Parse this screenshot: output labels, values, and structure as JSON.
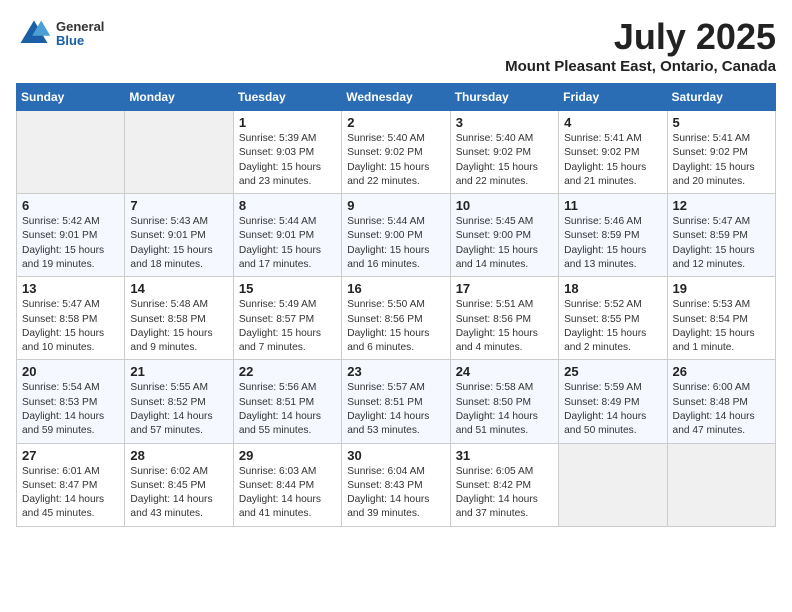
{
  "header": {
    "logo": {
      "general": "General",
      "blue": "Blue"
    },
    "title": "July 2025",
    "subtitle": "Mount Pleasant East, Ontario, Canada"
  },
  "weekdays": [
    "Sunday",
    "Monday",
    "Tuesday",
    "Wednesday",
    "Thursday",
    "Friday",
    "Saturday"
  ],
  "weeks": [
    [
      {
        "day": "",
        "empty": true
      },
      {
        "day": "",
        "empty": true
      },
      {
        "day": "1",
        "sunrise": "Sunrise: 5:39 AM",
        "sunset": "Sunset: 9:03 PM",
        "daylight": "Daylight: 15 hours and 23 minutes."
      },
      {
        "day": "2",
        "sunrise": "Sunrise: 5:40 AM",
        "sunset": "Sunset: 9:02 PM",
        "daylight": "Daylight: 15 hours and 22 minutes."
      },
      {
        "day": "3",
        "sunrise": "Sunrise: 5:40 AM",
        "sunset": "Sunset: 9:02 PM",
        "daylight": "Daylight: 15 hours and 22 minutes."
      },
      {
        "day": "4",
        "sunrise": "Sunrise: 5:41 AM",
        "sunset": "Sunset: 9:02 PM",
        "daylight": "Daylight: 15 hours and 21 minutes."
      },
      {
        "day": "5",
        "sunrise": "Sunrise: 5:41 AM",
        "sunset": "Sunset: 9:02 PM",
        "daylight": "Daylight: 15 hours and 20 minutes."
      }
    ],
    [
      {
        "day": "6",
        "sunrise": "Sunrise: 5:42 AM",
        "sunset": "Sunset: 9:01 PM",
        "daylight": "Daylight: 15 hours and 19 minutes."
      },
      {
        "day": "7",
        "sunrise": "Sunrise: 5:43 AM",
        "sunset": "Sunset: 9:01 PM",
        "daylight": "Daylight: 15 hours and 18 minutes."
      },
      {
        "day": "8",
        "sunrise": "Sunrise: 5:44 AM",
        "sunset": "Sunset: 9:01 PM",
        "daylight": "Daylight: 15 hours and 17 minutes."
      },
      {
        "day": "9",
        "sunrise": "Sunrise: 5:44 AM",
        "sunset": "Sunset: 9:00 PM",
        "daylight": "Daylight: 15 hours and 16 minutes."
      },
      {
        "day": "10",
        "sunrise": "Sunrise: 5:45 AM",
        "sunset": "Sunset: 9:00 PM",
        "daylight": "Daylight: 15 hours and 14 minutes."
      },
      {
        "day": "11",
        "sunrise": "Sunrise: 5:46 AM",
        "sunset": "Sunset: 8:59 PM",
        "daylight": "Daylight: 15 hours and 13 minutes."
      },
      {
        "day": "12",
        "sunrise": "Sunrise: 5:47 AM",
        "sunset": "Sunset: 8:59 PM",
        "daylight": "Daylight: 15 hours and 12 minutes."
      }
    ],
    [
      {
        "day": "13",
        "sunrise": "Sunrise: 5:47 AM",
        "sunset": "Sunset: 8:58 PM",
        "daylight": "Daylight: 15 hours and 10 minutes."
      },
      {
        "day": "14",
        "sunrise": "Sunrise: 5:48 AM",
        "sunset": "Sunset: 8:58 PM",
        "daylight": "Daylight: 15 hours and 9 minutes."
      },
      {
        "day": "15",
        "sunrise": "Sunrise: 5:49 AM",
        "sunset": "Sunset: 8:57 PM",
        "daylight": "Daylight: 15 hours and 7 minutes."
      },
      {
        "day": "16",
        "sunrise": "Sunrise: 5:50 AM",
        "sunset": "Sunset: 8:56 PM",
        "daylight": "Daylight: 15 hours and 6 minutes."
      },
      {
        "day": "17",
        "sunrise": "Sunrise: 5:51 AM",
        "sunset": "Sunset: 8:56 PM",
        "daylight": "Daylight: 15 hours and 4 minutes."
      },
      {
        "day": "18",
        "sunrise": "Sunrise: 5:52 AM",
        "sunset": "Sunset: 8:55 PM",
        "daylight": "Daylight: 15 hours and 2 minutes."
      },
      {
        "day": "19",
        "sunrise": "Sunrise: 5:53 AM",
        "sunset": "Sunset: 8:54 PM",
        "daylight": "Daylight: 15 hours and 1 minute."
      }
    ],
    [
      {
        "day": "20",
        "sunrise": "Sunrise: 5:54 AM",
        "sunset": "Sunset: 8:53 PM",
        "daylight": "Daylight: 14 hours and 59 minutes."
      },
      {
        "day": "21",
        "sunrise": "Sunrise: 5:55 AM",
        "sunset": "Sunset: 8:52 PM",
        "daylight": "Daylight: 14 hours and 57 minutes."
      },
      {
        "day": "22",
        "sunrise": "Sunrise: 5:56 AM",
        "sunset": "Sunset: 8:51 PM",
        "daylight": "Daylight: 14 hours and 55 minutes."
      },
      {
        "day": "23",
        "sunrise": "Sunrise: 5:57 AM",
        "sunset": "Sunset: 8:51 PM",
        "daylight": "Daylight: 14 hours and 53 minutes."
      },
      {
        "day": "24",
        "sunrise": "Sunrise: 5:58 AM",
        "sunset": "Sunset: 8:50 PM",
        "daylight": "Daylight: 14 hours and 51 minutes."
      },
      {
        "day": "25",
        "sunrise": "Sunrise: 5:59 AM",
        "sunset": "Sunset: 8:49 PM",
        "daylight": "Daylight: 14 hours and 50 minutes."
      },
      {
        "day": "26",
        "sunrise": "Sunrise: 6:00 AM",
        "sunset": "Sunset: 8:48 PM",
        "daylight": "Daylight: 14 hours and 47 minutes."
      }
    ],
    [
      {
        "day": "27",
        "sunrise": "Sunrise: 6:01 AM",
        "sunset": "Sunset: 8:47 PM",
        "daylight": "Daylight: 14 hours and 45 minutes."
      },
      {
        "day": "28",
        "sunrise": "Sunrise: 6:02 AM",
        "sunset": "Sunset: 8:45 PM",
        "daylight": "Daylight: 14 hours and 43 minutes."
      },
      {
        "day": "29",
        "sunrise": "Sunrise: 6:03 AM",
        "sunset": "Sunset: 8:44 PM",
        "daylight": "Daylight: 14 hours and 41 minutes."
      },
      {
        "day": "30",
        "sunrise": "Sunrise: 6:04 AM",
        "sunset": "Sunset: 8:43 PM",
        "daylight": "Daylight: 14 hours and 39 minutes."
      },
      {
        "day": "31",
        "sunrise": "Sunrise: 6:05 AM",
        "sunset": "Sunset: 8:42 PM",
        "daylight": "Daylight: 14 hours and 37 minutes."
      },
      {
        "day": "",
        "empty": true
      },
      {
        "day": "",
        "empty": true
      }
    ]
  ]
}
